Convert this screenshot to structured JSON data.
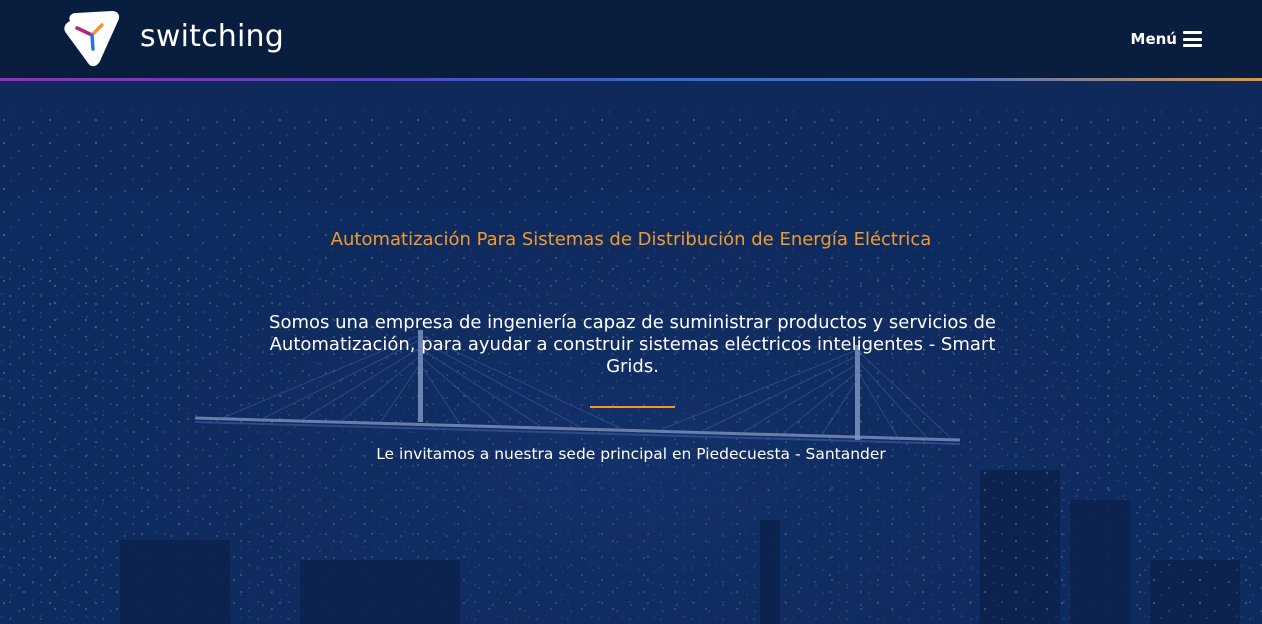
{
  "header": {
    "brand_name": "switching",
    "menu_label": "Menú",
    "menu_icon": "hamburger-icon",
    "logo_icon": "switching-logo-icon"
  },
  "hero": {
    "title": "Automatización Para Sistemas de Distribución de Energía Eléctrica",
    "description": "Somos una empresa de ingeniería capaz de suministrar productos y servicios de Automatización, para ayudar a construir sistemas eléctricos inteligentes - Smart Grids.",
    "invite": "Le invitamos a nuestra sede principal en Piedecuesta - Santander"
  },
  "colors": {
    "header_bg": "#091d3c",
    "overlay": "#0d2349",
    "accent": "#f39a2e",
    "text": "#ffffff",
    "stripe_start": "#a126c2",
    "stripe_end": "#e8942a"
  }
}
